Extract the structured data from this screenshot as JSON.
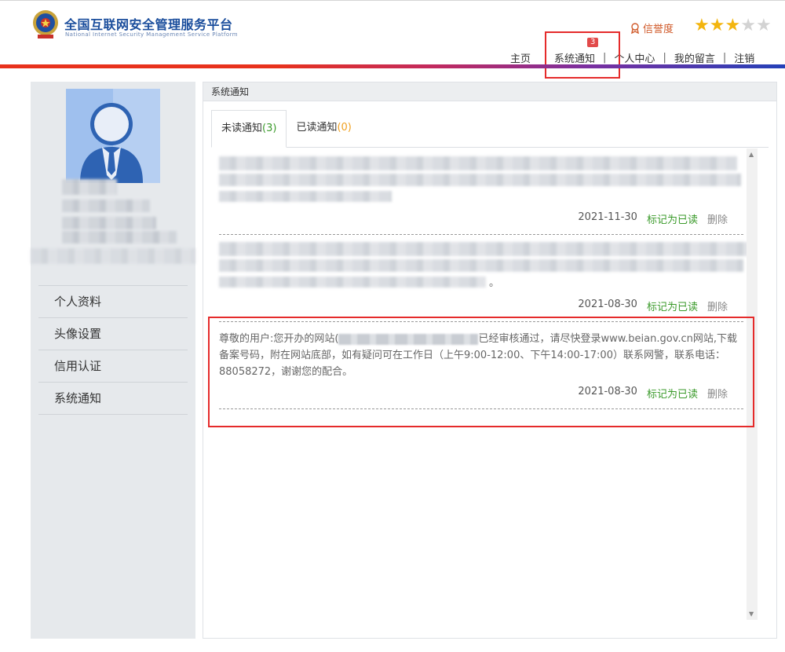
{
  "header": {
    "title": "全国互联网安全管理服务平台",
    "subtitle": "National Internet Security Management Service Platform",
    "credit_label": "信誉度",
    "stars_on": 3,
    "stars_total": 5,
    "star_glyph": "★"
  },
  "topnav": {
    "home": "主页",
    "notice": "系统通知",
    "notice_badge": "3",
    "personal": "个人中心",
    "messages": "我的留言",
    "logout": "注销",
    "sep": "|"
  },
  "sidebar": {
    "items": [
      "个人资料",
      "头像设置",
      "信用认证",
      "系统通知"
    ]
  },
  "panel": {
    "title": "系统通知",
    "tab_unread_label": "未读通知",
    "tab_unread_count": "(3)",
    "tab_read_label": "已读通知",
    "tab_read_count": "(0)"
  },
  "messages": [
    {
      "date": "2021-11-30",
      "mark": "标记为已读",
      "del": "删除"
    },
    {
      "date": "2021-08-30",
      "mark": "标记为已读",
      "del": "删除",
      "tail": "。"
    },
    {
      "text_a": "尊敬的用户:您开办的网站(",
      "text_b": "已经审核通过，请尽快登录www.beian.gov.cn网站,下载备案号码，附在网站底部，如有疑问可在工作日（上午9:00-12:00、下午14:00-17:00）联系网警，联系电话：88058272，谢谢您的配合。",
      "date": "2021-08-30",
      "mark": "标记为已读",
      "del": "删除"
    }
  ],
  "colors": {
    "accent_red": "#e52b2b",
    "brand_blue": "#1a4d9c",
    "green": "#3a9a2a",
    "orange": "#f0a020"
  }
}
